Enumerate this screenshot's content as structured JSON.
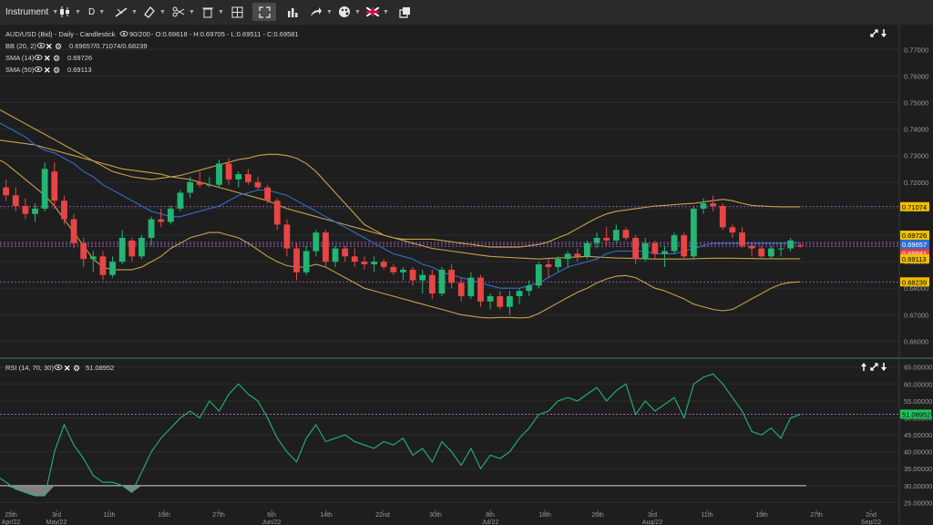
{
  "toolbar": {
    "instrument": "Instrument",
    "timeframe": "D",
    "flag_colors": [
      "#012169",
      "#C8102E",
      "#ffffff"
    ]
  },
  "legend": {
    "symbol_line": "AUD/USD (Bid) - Daily - Candlestick",
    "range": "90/200",
    "ohlc": "- O:0.69618 - H:0.69705 - L:0.69511 - C:0.69581",
    "bb_label": "BB (20, 2)",
    "bb_values": "0.69657/0.71074/0.68239",
    "sma14_label": "SMA (14)",
    "sma14_value": "0.69726",
    "sma50_label": "SMA (50)",
    "sma50_value": "0.69113"
  },
  "rsi_legend": {
    "label": "RSI (14, 70, 30)",
    "value": "51.08952"
  },
  "price_axis": [
    "0.77000",
    "0.76000",
    "0.75000",
    "0.74000",
    "0.73000",
    "0.72000",
    "0.71000",
    "0.70000",
    "0.69000",
    "0.68000",
    "0.67000",
    "0.66000"
  ],
  "price_badges": [
    {
      "text": "0.71074",
      "bg": "#f0c000",
      "fg": "#000000"
    },
    {
      "text": "0.69726",
      "bg": "#f0c000",
      "fg": "#000000"
    },
    {
      "text": "0.69657",
      "bg": "#2f6fd1",
      "fg": "#ffffff"
    },
    {
      "text": "0.69581",
      "bg": "#e84545",
      "fg": "#ffffff"
    },
    {
      "text": "0.69113",
      "bg": "#f0c000",
      "fg": "#000000"
    },
    {
      "text": "0.68239",
      "bg": "#f0c000",
      "fg": "#000000"
    }
  ],
  "rsi_axis": [
    "65.00000",
    "60.00000",
    "55.00000",
    "50.00000",
    "45.00000",
    "40.00000",
    "35.00000",
    "30.00000",
    "25.00000"
  ],
  "rsi_badge": {
    "text": "51.08952",
    "bg": "#22c55e",
    "fg": "#000000"
  },
  "date_axis": [
    {
      "top": "25th",
      "bottom": "Apr/22"
    },
    {
      "top": "3rd",
      "bottom": "May/22"
    },
    {
      "top": "11th",
      "bottom": ""
    },
    {
      "top": "19th",
      "bottom": ""
    },
    {
      "top": "27th",
      "bottom": ""
    },
    {
      "top": "6th",
      "bottom": "Jun/22"
    },
    {
      "top": "14th",
      "bottom": ""
    },
    {
      "top": "22nd",
      "bottom": ""
    },
    {
      "top": "30th",
      "bottom": ""
    },
    {
      "top": "8th",
      "bottom": "Jul/22"
    },
    {
      "top": "18th",
      "bottom": ""
    },
    {
      "top": "26th",
      "bottom": ""
    },
    {
      "top": "3rd",
      "bottom": "Aug/22"
    },
    {
      "top": "11th",
      "bottom": ""
    },
    {
      "top": "19th",
      "bottom": ""
    },
    {
      "top": "27th",
      "bottom": ""
    },
    {
      "top": "2nd",
      "bottom": "Sep/22"
    }
  ],
  "chart_data": {
    "type": "candlestick",
    "title": "AUD/USD (Bid) - Daily - Candlestick",
    "ylim": [
      0.655,
      0.778
    ],
    "rsi_ylim": [
      23.5,
      66
    ],
    "last_close": 0.69581,
    "candles": [
      [
        0.7255,
        0.73,
        0.715,
        0.718
      ],
      [
        0.718,
        0.721,
        0.713,
        0.715
      ],
      [
        0.715,
        0.718,
        0.709,
        0.711
      ],
      [
        0.711,
        0.714,
        0.706,
        0.708
      ],
      [
        0.708,
        0.712,
        0.705,
        0.71
      ],
      [
        0.71,
        0.7275,
        0.709,
        0.725
      ],
      [
        0.724,
        0.7275,
        0.71,
        0.713
      ],
      [
        0.713,
        0.715,
        0.704,
        0.706
      ],
      [
        0.706,
        0.708,
        0.695,
        0.697
      ],
      [
        0.697,
        0.699,
        0.688,
        0.691
      ],
      [
        0.691,
        0.694,
        0.686,
        0.692
      ],
      [
        0.692,
        0.694,
        0.683,
        0.685
      ],
      [
        0.685,
        0.692,
        0.684,
        0.69
      ],
      [
        0.69,
        0.702,
        0.689,
        0.699
      ],
      [
        0.698,
        0.699,
        0.69,
        0.692
      ],
      [
        0.692,
        0.7,
        0.691,
        0.699
      ],
      [
        0.699,
        0.707,
        0.696,
        0.706
      ],
      [
        0.706,
        0.71,
        0.703,
        0.705
      ],
      [
        0.705,
        0.711,
        0.704,
        0.71
      ],
      [
        0.71,
        0.717,
        0.709,
        0.716
      ],
      [
        0.716,
        0.722,
        0.714,
        0.72
      ],
      [
        0.72,
        0.724,
        0.718,
        0.719
      ],
      [
        0.719,
        0.722,
        0.718,
        0.719
      ],
      [
        0.719,
        0.7285,
        0.718,
        0.727
      ],
      [
        0.727,
        0.729,
        0.719,
        0.721
      ],
      [
        0.721,
        0.724,
        0.718,
        0.723
      ],
      [
        0.723,
        0.725,
        0.719,
        0.72
      ],
      [
        0.72,
        0.722,
        0.717,
        0.718
      ],
      [
        0.718,
        0.719,
        0.712,
        0.713
      ],
      [
        0.713,
        0.714,
        0.702,
        0.704
      ],
      [
        0.704,
        0.706,
        0.692,
        0.695
      ],
      [
        0.695,
        0.697,
        0.683,
        0.686
      ],
      [
        0.686,
        0.696,
        0.685,
        0.694
      ],
      [
        0.694,
        0.702,
        0.692,
        0.701
      ],
      [
        0.701,
        0.702,
        0.688,
        0.69
      ],
      [
        0.69,
        0.696,
        0.688,
        0.695
      ],
      [
        0.695,
        0.696,
        0.69,
        0.692
      ],
      [
        0.692,
        0.695,
        0.688,
        0.69
      ],
      [
        0.69,
        0.692,
        0.687,
        0.689
      ],
      [
        0.689,
        0.692,
        0.686,
        0.69
      ],
      [
        0.69,
        0.691,
        0.687,
        0.688
      ],
      [
        0.688,
        0.689,
        0.685,
        0.686
      ],
      [
        0.686,
        0.688,
        0.683,
        0.687
      ],
      [
        0.687,
        0.688,
        0.681,
        0.683
      ],
      [
        0.683,
        0.687,
        0.678,
        0.685
      ],
      [
        0.685,
        0.687,
        0.676,
        0.678
      ],
      [
        0.678,
        0.688,
        0.677,
        0.687
      ],
      [
        0.687,
        0.689,
        0.68,
        0.682
      ],
      [
        0.682,
        0.684,
        0.675,
        0.677
      ],
      [
        0.677,
        0.686,
        0.676,
        0.684
      ],
      [
        0.684,
        0.685,
        0.673,
        0.675
      ],
      [
        0.675,
        0.678,
        0.672,
        0.677
      ],
      [
        0.677,
        0.679,
        0.672,
        0.673
      ],
      [
        0.673,
        0.679,
        0.67,
        0.677
      ],
      [
        0.677,
        0.68,
        0.674,
        0.679
      ],
      [
        0.679,
        0.683,
        0.677,
        0.681
      ],
      [
        0.681,
        0.69,
        0.68,
        0.689
      ],
      [
        0.689,
        0.691,
        0.684,
        0.688
      ],
      [
        0.688,
        0.692,
        0.686,
        0.691
      ],
      [
        0.691,
        0.694,
        0.688,
        0.693
      ],
      [
        0.693,
        0.695,
        0.69,
        0.692
      ],
      [
        0.692,
        0.698,
        0.691,
        0.697
      ],
      [
        0.697,
        0.701,
        0.695,
        0.699
      ],
      [
        0.699,
        0.703,
        0.696,
        0.698
      ],
      [
        0.698,
        0.704,
        0.697,
        0.702
      ],
      [
        0.702,
        0.703,
        0.698,
        0.699
      ],
      [
        0.699,
        0.7,
        0.689,
        0.691
      ],
      [
        0.691,
        0.699,
        0.69,
        0.697
      ],
      [
        0.697,
        0.698,
        0.691,
        0.693
      ],
      [
        0.693,
        0.696,
        0.688,
        0.694
      ],
      [
        0.694,
        0.701,
        0.693,
        0.7
      ],
      [
        0.7,
        0.701,
        0.691,
        0.692
      ],
      [
        0.692,
        0.711,
        0.691,
        0.71
      ],
      [
        0.71,
        0.714,
        0.708,
        0.712
      ],
      [
        0.712,
        0.715,
        0.709,
        0.711
      ],
      [
        0.711,
        0.712,
        0.702,
        0.703
      ],
      [
        0.703,
        0.704,
        0.699,
        0.701
      ],
      [
        0.701,
        0.703,
        0.695,
        0.696
      ],
      [
        0.696,
        0.697,
        0.692,
        0.695
      ],
      [
        0.695,
        0.696,
        0.691,
        0.692
      ],
      [
        0.692,
        0.696,
        0.691,
        0.695
      ],
      [
        0.695,
        0.697,
        0.692,
        0.695
      ],
      [
        0.695,
        0.699,
        0.694,
        0.698
      ],
      [
        0.6962,
        0.6971,
        0.6951,
        0.6958
      ]
    ],
    "rsi": [
      33,
      31,
      29,
      28,
      27,
      27,
      40,
      48,
      42,
      38,
      33,
      31,
      31,
      30,
      28,
      34,
      40,
      44,
      47,
      50,
      52,
      50,
      55,
      52,
      57,
      60,
      57,
      55,
      50,
      44,
      40,
      37,
      44,
      48,
      43,
      44,
      45,
      43,
      42,
      41,
      43,
      42,
      44,
      39,
      41,
      37,
      43,
      40,
      36,
      41,
      35,
      39,
      38,
      40,
      44,
      47,
      51,
      52,
      55,
      56,
      55,
      57,
      59,
      55,
      58,
      60,
      51,
      55,
      52,
      54,
      56,
      50,
      60,
      62,
      63,
      60,
      56,
      52,
      46,
      45,
      47,
      44,
      50,
      51
    ],
    "sma14": [
      0.743,
      0.741,
      0.739,
      0.737,
      0.734,
      0.732,
      0.731,
      0.729,
      0.727,
      0.724,
      0.722,
      0.719,
      0.717,
      0.715,
      0.713,
      0.711,
      0.709,
      0.708,
      0.707,
      0.707,
      0.708,
      0.709,
      0.71,
      0.711,
      0.713,
      0.715,
      0.716,
      0.717,
      0.717,
      0.716,
      0.715,
      0.713,
      0.711,
      0.709,
      0.707,
      0.705,
      0.703,
      0.701,
      0.699,
      0.697,
      0.695,
      0.693,
      0.692,
      0.691,
      0.689,
      0.688,
      0.686,
      0.685,
      0.684,
      0.683,
      0.682,
      0.681,
      0.68,
      0.68,
      0.68,
      0.681,
      0.682,
      0.684,
      0.686,
      0.688,
      0.689,
      0.69,
      0.691,
      0.693,
      0.694,
      0.694,
      0.694,
      0.694,
      0.693,
      0.693,
      0.693,
      0.694,
      0.695,
      0.696,
      0.697,
      0.697,
      0.697,
      0.697,
      0.697,
      0.697,
      0.697,
      0.697,
      0.697,
      0.6973
    ],
    "sma50": [
      0.736,
      0.7355,
      0.735,
      0.7345,
      0.734,
      0.733,
      0.732,
      0.731,
      0.73,
      0.729,
      0.728,
      0.727,
      0.726,
      0.725,
      0.7245,
      0.724,
      0.7235,
      0.723,
      0.722,
      0.7215,
      0.721,
      0.72,
      0.719,
      0.718,
      0.717,
      0.716,
      0.715,
      0.714,
      0.713,
      0.7115,
      0.71,
      0.709,
      0.708,
      0.707,
      0.706,
      0.705,
      0.704,
      0.703,
      0.702,
      0.701,
      0.7,
      0.699,
      0.698,
      0.697,
      0.696,
      0.695,
      0.6945,
      0.694,
      0.6935,
      0.693,
      0.6925,
      0.692,
      0.6918,
      0.6916,
      0.6914,
      0.6912,
      0.691,
      0.6912,
      0.6914,
      0.6916,
      0.6918,
      0.692,
      0.6918,
      0.6916,
      0.6914,
      0.6913,
      0.6912,
      0.6911,
      0.691,
      0.691,
      0.691,
      0.691,
      0.6911,
      0.6912,
      0.6913,
      0.6913,
      0.6913,
      0.6912,
      0.6912,
      0.6911,
      0.6911,
      0.6911,
      0.6911,
      0.6911
    ],
    "bb_upper": [
      0.748,
      0.746,
      0.744,
      0.742,
      0.74,
      0.738,
      0.736,
      0.734,
      0.732,
      0.73,
      0.728,
      0.726,
      0.724,
      0.723,
      0.722,
      0.7215,
      0.721,
      0.7215,
      0.722,
      0.7225,
      0.7235,
      0.7245,
      0.7255,
      0.7265,
      0.7275,
      0.7285,
      0.729,
      0.73,
      0.7305,
      0.7305,
      0.73,
      0.729,
      0.727,
      0.724,
      0.72,
      0.716,
      0.712,
      0.708,
      0.704,
      0.702,
      0.7,
      0.699,
      0.6985,
      0.6985,
      0.6985,
      0.6985,
      0.698,
      0.6975,
      0.697,
      0.6965,
      0.696,
      0.6955,
      0.6955,
      0.6955,
      0.6955,
      0.696,
      0.6965,
      0.6975,
      0.699,
      0.7005,
      0.7025,
      0.7045,
      0.7065,
      0.708,
      0.709,
      0.7095,
      0.71,
      0.7105,
      0.711,
      0.7112,
      0.7115,
      0.7118,
      0.712,
      0.7125,
      0.713,
      0.7135,
      0.713,
      0.712,
      0.7112,
      0.711,
      0.7108,
      0.7107,
      0.7107,
      0.7107
    ],
    "bb_lower": [
      0.729,
      0.727,
      0.724,
      0.721,
      0.718,
      0.715,
      0.711,
      0.706,
      0.701,
      0.696,
      0.691,
      0.688,
      0.687,
      0.687,
      0.687,
      0.688,
      0.69,
      0.692,
      0.695,
      0.697,
      0.699,
      0.7,
      0.701,
      0.701,
      0.7,
      0.699,
      0.697,
      0.6945,
      0.692,
      0.69,
      0.6885,
      0.688,
      0.688,
      0.689,
      0.688,
      0.686,
      0.684,
      0.682,
      0.68,
      0.679,
      0.678,
      0.677,
      0.676,
      0.675,
      0.674,
      0.673,
      0.672,
      0.671,
      0.67,
      0.6695,
      0.669,
      0.6688,
      0.669,
      0.669,
      0.6688,
      0.669,
      0.6705,
      0.6725,
      0.6745,
      0.6765,
      0.6785,
      0.68,
      0.682,
      0.6835,
      0.6845,
      0.6848,
      0.684,
      0.682,
      0.68,
      0.679,
      0.6775,
      0.676,
      0.674,
      0.673,
      0.672,
      0.6715,
      0.672,
      0.674,
      0.676,
      0.678,
      0.68,
      0.6815,
      0.6822,
      0.6824
    ]
  }
}
